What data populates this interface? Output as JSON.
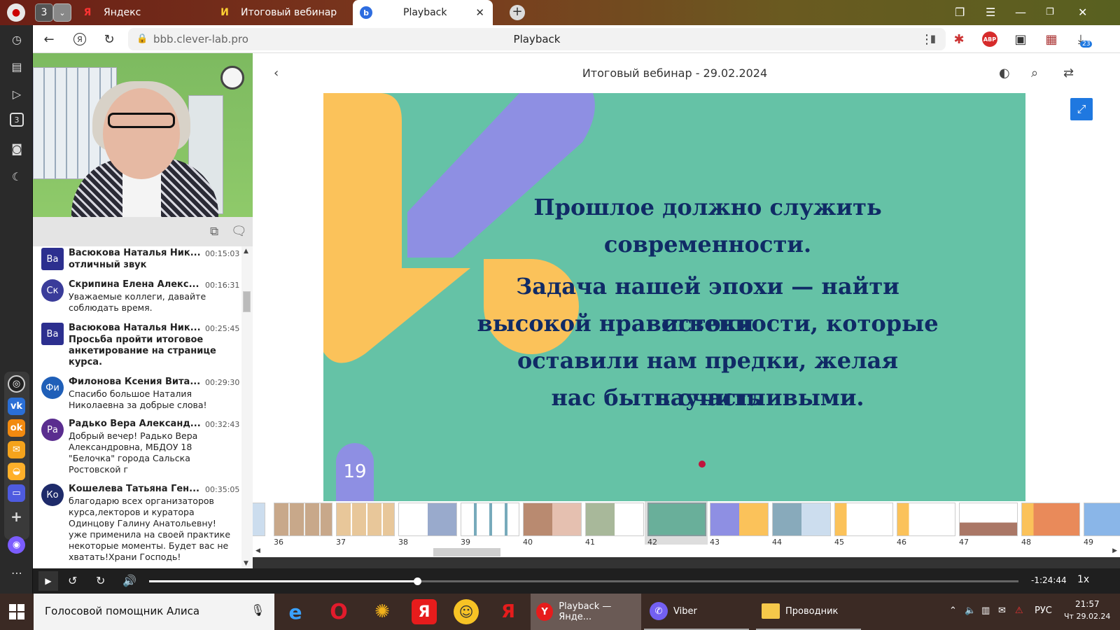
{
  "browser": {
    "tab_counter": "3",
    "tabs": [
      {
        "label": "Яндекс"
      },
      {
        "label": "Итоговый вебинар"
      },
      {
        "label": "Playback"
      }
    ],
    "url": "bbb.clever-lab.pro",
    "page_title": "Playback",
    "ext_badge": "23"
  },
  "sidebar": {
    "tab_number": "3"
  },
  "presentation": {
    "title": "Итоговый вебинар - 29.02.2024",
    "slide_lines": [
      "Прошлое должно служить",
      "современности.",
      "Задача нашей эпохи — найти истоки",
      "высокой нравственности, которые",
      "оставили нам предки, желая научить",
      "нас быть счастливыми."
    ],
    "slide_number": "19"
  },
  "chat": {
    "messages": [
      {
        "initials": "Ва",
        "color": "#2c2f8f",
        "name": "Васюкова Наталья Ник...",
        "time": "00:15:03",
        "text": "отличный звук",
        "bold": true
      },
      {
        "initials": "Ск",
        "color": "#3a3c9a",
        "name": "Скрипина Елена Алекс...",
        "time": "00:16:31",
        "text": "Уважаемые коллеги, давайте соблюдать время.",
        "bold": false
      },
      {
        "initials": "Ва",
        "color": "#2c2f8f",
        "name": "Васюкова Наталья Ник...",
        "time": "00:25:45",
        "text": "Просьба пройти итоговое анкетирование на странице курса.",
        "bold": true
      },
      {
        "initials": "Фи",
        "color": "#1f5fb8",
        "name": "Филонова Ксения Вита...",
        "time": "00:29:30",
        "text": "Спасибо большое Наталия Николаевна за добрые слова!",
        "bold": false
      },
      {
        "initials": "Ра",
        "color": "#5a2d8f",
        "name": "Радько Вера Александ...",
        "time": "00:32:43",
        "text": "Добрый вечер! Радько Вера Александровна, МБДОУ 18 \"Белочка\" города Сальска Ростовской г",
        "bold": false
      },
      {
        "initials": "Ко",
        "color": "#1e2b6a",
        "name": "Кошелева Татьяна Ген...",
        "time": "00:35:05",
        "text": "благодарю всех организаторов курса,лекторов и куратора Одинцову Галину Анатольевну! уже применила на своей практике некоторые моменты. Будет вас не хватать!Храни Господь!",
        "bold": false
      }
    ]
  },
  "thumbnails": [
    "36",
    "37",
    "38",
    "39",
    "40",
    "41",
    "42",
    "43",
    "44",
    "45",
    "46",
    "47",
    "48",
    "49"
  ],
  "player": {
    "time_remaining": "-1:24:44",
    "speed": "1x",
    "progress": 0.308
  },
  "taskbar": {
    "search_text": "Голосовой помощник Алиса",
    "tasks": [
      {
        "label": "Playback — Янде..."
      },
      {
        "label": "Viber"
      },
      {
        "label": "Проводник"
      }
    ],
    "lang": "РУС",
    "time": "21:57",
    "date": "Чт 29.02.24"
  }
}
